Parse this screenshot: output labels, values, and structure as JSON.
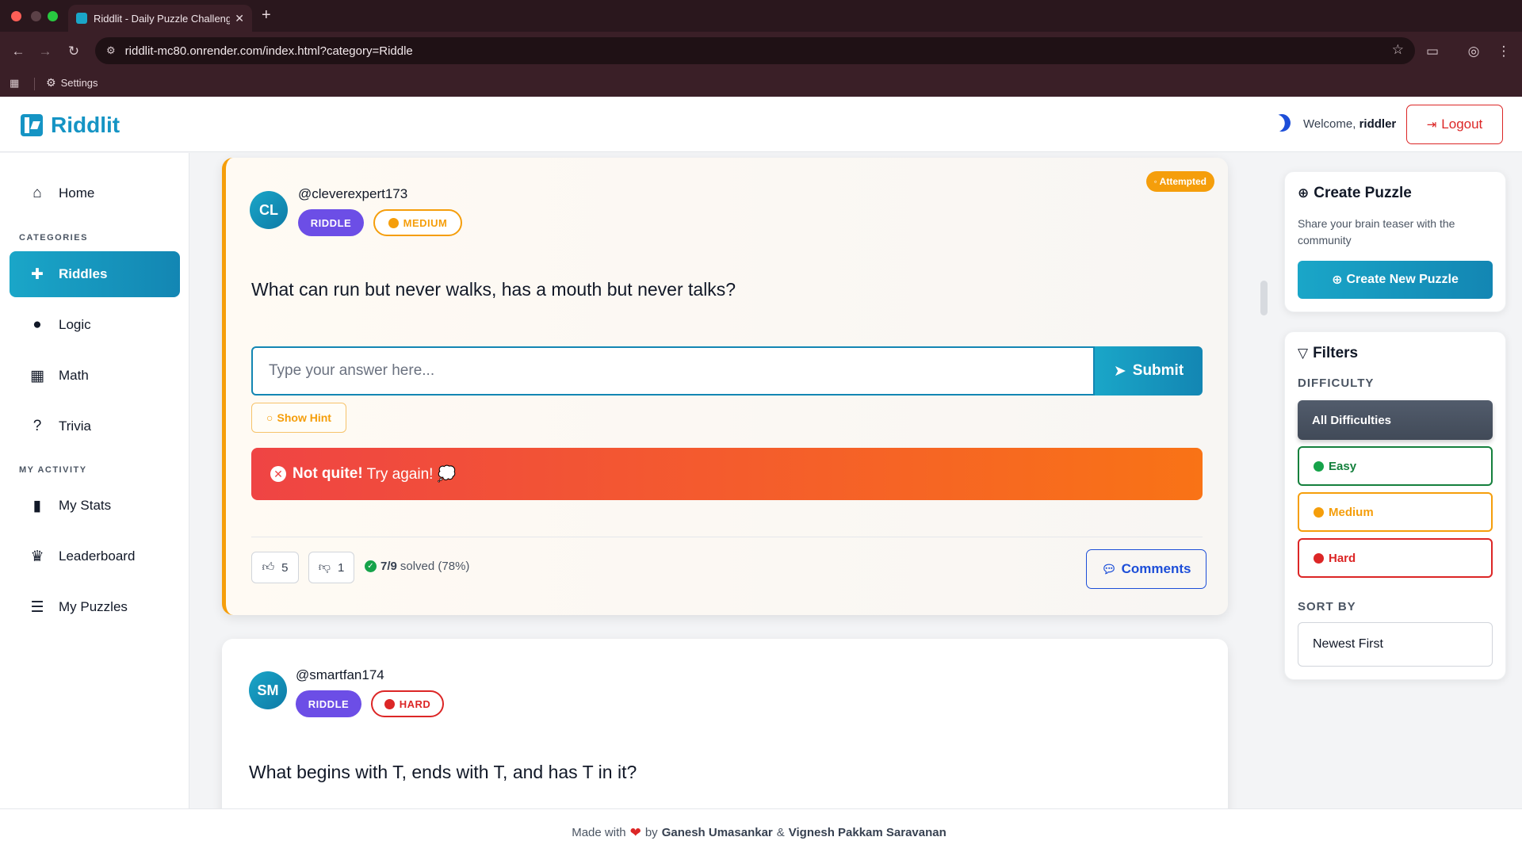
{
  "browser": {
    "tab_title": "Riddlit - Daily Puzzle Challenge",
    "url": "riddlit-mc80.onrender.com/index.html?category=Riddle",
    "bookmark_settings": "Settings"
  },
  "header": {
    "logo_text": "Riddlit",
    "welcome_prefix": "Welcome,",
    "username": "riddler",
    "logout_label": "Logout"
  },
  "sidebar": {
    "home": "Home",
    "categories_label": "CATEGORIES",
    "riddles": "Riddles",
    "logic": "Logic",
    "math": "Math",
    "trivia": "Trivia",
    "activity_label": "MY ACTIVITY",
    "stats": "My Stats",
    "leaderboard": "Leaderboard",
    "puzzles": "My Puzzles"
  },
  "puzzle1": {
    "status": "Attempted",
    "avatar": "CL",
    "author": "@cleverexpert173",
    "category": "RIDDLE",
    "difficulty": "MEDIUM",
    "question": "What can run but never walks, has a mouth but never talks?",
    "answer_placeholder": "Type your answer here...",
    "submit_label": "Submit",
    "hint_label": "Show Hint",
    "error_strong": "Not quite!",
    "error_text": "Try again! 💭",
    "likes": "5",
    "dislikes": "1",
    "solved_count": "7/9",
    "solved_text": "solved (78%)",
    "comments_label": "Comments"
  },
  "puzzle2": {
    "avatar": "SM",
    "author": "@smartfan174",
    "category": "RIDDLE",
    "difficulty": "HARD",
    "question": "What begins with T, ends with T, and has T in it?"
  },
  "create_panel": {
    "title": "Create Puzzle",
    "description": "Share your brain teaser with the community",
    "button": "Create New Puzzle"
  },
  "filters": {
    "title": "Filters",
    "difficulty_label": "DIFFICULTY",
    "all": "All Difficulties",
    "easy": "Easy",
    "medium": "Medium",
    "hard": "Hard",
    "sort_label": "SORT BY",
    "sort_value": "Newest First"
  },
  "footer": {
    "made_with": "Made with",
    "by": "by",
    "author1": "Ganesh Umasankar",
    "amp": "&",
    "author2": "Vignesh Pakkam Saravanan"
  },
  "colors": {
    "brand": "#1594c4",
    "accent_purple": "#6c4ee6",
    "medium": "#f59e0b",
    "hard": "#dc2626",
    "easy": "#15803d"
  }
}
